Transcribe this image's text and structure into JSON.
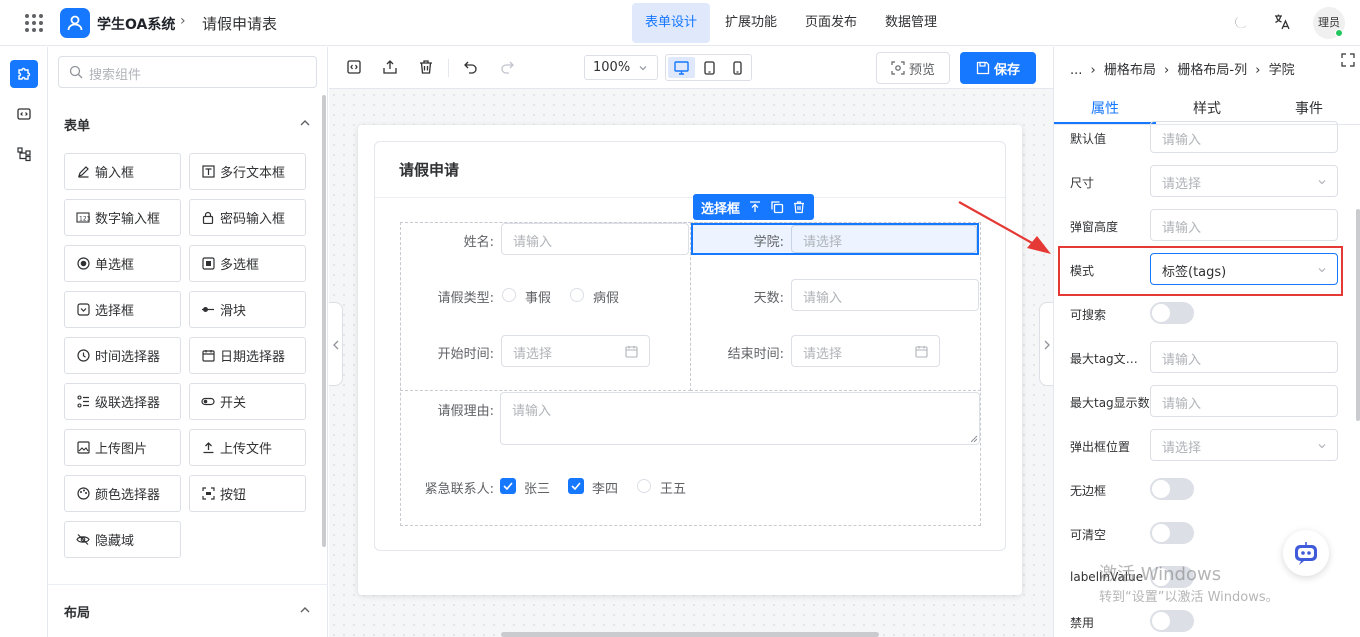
{
  "header": {
    "system_name": "学生OA系统",
    "breadcrumb_sep": "›",
    "page_name": "请假申请表",
    "nav": [
      {
        "label": "表单设计",
        "active": true
      },
      {
        "label": "扩展功能",
        "active": false
      },
      {
        "label": "页面发布",
        "active": false
      },
      {
        "label": "数据管理",
        "active": false
      }
    ],
    "user": "理员",
    "accent": "#1677ff"
  },
  "sidebar": {
    "search_placeholder": "搜索组件",
    "form_section": "表单",
    "layout_section": "布局",
    "components": [
      {
        "label": "输入框",
        "icon": "pencil-icon"
      },
      {
        "label": "多行文本框",
        "icon": "textarea-icon"
      },
      {
        "label": "数字输入框",
        "icon": "number-icon"
      },
      {
        "label": "密码输入框",
        "icon": "lock-icon"
      },
      {
        "label": "单选框",
        "icon": "radio-icon"
      },
      {
        "label": "多选框",
        "icon": "checkbox-icon"
      },
      {
        "label": "选择框",
        "icon": "select-icon"
      },
      {
        "label": "滑块",
        "icon": "slider-icon"
      },
      {
        "label": "时间选择器",
        "icon": "clock-icon"
      },
      {
        "label": "日期选择器",
        "icon": "calendar-icon"
      },
      {
        "label": "级联选择器",
        "icon": "cascader-icon"
      },
      {
        "label": "开关",
        "icon": "switch-icon"
      },
      {
        "label": "上传图片",
        "icon": "image-icon"
      },
      {
        "label": "上传文件",
        "icon": "upload-icon"
      },
      {
        "label": "颜色选择器",
        "icon": "palette-icon"
      },
      {
        "label": "按钮",
        "icon": "button-icon"
      },
      {
        "label": "隐藏域",
        "icon": "eye-off-icon"
      }
    ]
  },
  "toolbar": {
    "zoom": "100%",
    "preview_label": "预览",
    "save_label": "保存"
  },
  "form": {
    "title": "请假申请",
    "selected_tag": "选择框",
    "name_label": "姓名:",
    "name_placeholder": "请输入",
    "college_label": "学院:",
    "college_placeholder": "请选择",
    "leave_type_label": "请假类型:",
    "leave_type_options": [
      "事假",
      "病假"
    ],
    "days_label": "天数:",
    "days_placeholder": "请输入",
    "start_label": "开始时间:",
    "start_placeholder": "请选择",
    "end_label": "结束时间:",
    "end_placeholder": "请选择",
    "reason_label": "请假理由:",
    "reason_placeholder": "请输入",
    "contact_label": "紧急联系人:",
    "contacts": [
      {
        "label": "张三",
        "checked": true
      },
      {
        "label": "李四",
        "checked": true
      },
      {
        "label": "王五",
        "checked": false
      }
    ]
  },
  "props": {
    "breadcrumb": [
      "...",
      "栅格布局",
      "栅格布局-列",
      "学院"
    ],
    "tabs": [
      "属性",
      "样式",
      "事件"
    ],
    "rows": [
      {
        "label": "默认值",
        "kind": "input",
        "placeholder": "请输入"
      },
      {
        "label": "尺寸",
        "kind": "select",
        "placeholder": "请选择"
      },
      {
        "label": "弹窗高度",
        "kind": "input",
        "placeholder": "请输入"
      },
      {
        "label": "模式",
        "kind": "select",
        "value": "标签(tags)"
      },
      {
        "label": "可搜索",
        "kind": "toggle"
      },
      {
        "label": "最大tag文本长度",
        "kind": "input",
        "placeholder": "请输入"
      },
      {
        "label": "最大tag显示数",
        "kind": "input",
        "placeholder": "请输入"
      },
      {
        "label": "弹出框位置",
        "kind": "select",
        "placeholder": "请选择"
      },
      {
        "label": "无边框",
        "kind": "toggle"
      },
      {
        "label": "可清空",
        "kind": "toggle"
      },
      {
        "label": "labelInValue",
        "kind": "toggle"
      },
      {
        "label": "禁用",
        "kind": "toggle"
      }
    ]
  },
  "watermark": {
    "line1": "激活 Windows",
    "line2": "转到“设置”以激活 Windows。"
  }
}
